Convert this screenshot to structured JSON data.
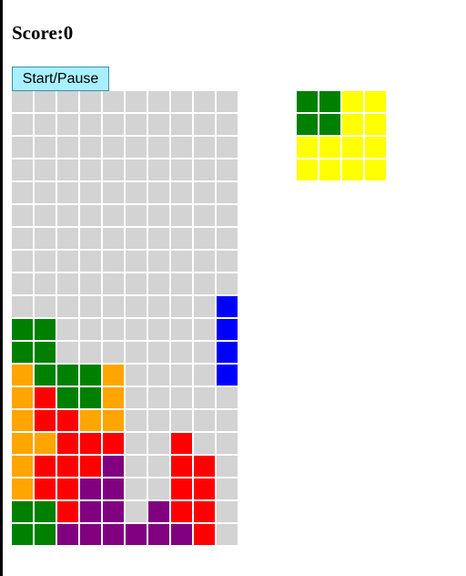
{
  "score_label": "Score:",
  "score_value": "0",
  "start_button_label": "Start/Pause",
  "colors": {
    "empty": "#d3d3d3",
    "green": "#008000",
    "blue": "#0000ff",
    "orange": "#ffa500",
    "red": "#ff0000",
    "purple": "#800080",
    "yellow": "#ffff00"
  },
  "board": {
    "columns": 10,
    "rows": 20,
    "cells": [
      "..........",
      "..........",
      "..........",
      "..........",
      "..........",
      "..........",
      "..........",
      "..........",
      "..........",
      ".........B",
      "GG.......B",
      "GG.......B",
      "OGGGO....B",
      "ORGGO.....",
      "ORROO.....",
      "OORRR..R..",
      "ORRRP..RR.",
      "ORRPP..RR.",
      "GGRPP.PRR.",
      "GGPPPPPPR."
    ]
  },
  "next_piece": {
    "columns": 4,
    "rows": 4,
    "cells": [
      "GGYY",
      "GGYY",
      "YYYY",
      "YYYY"
    ]
  }
}
